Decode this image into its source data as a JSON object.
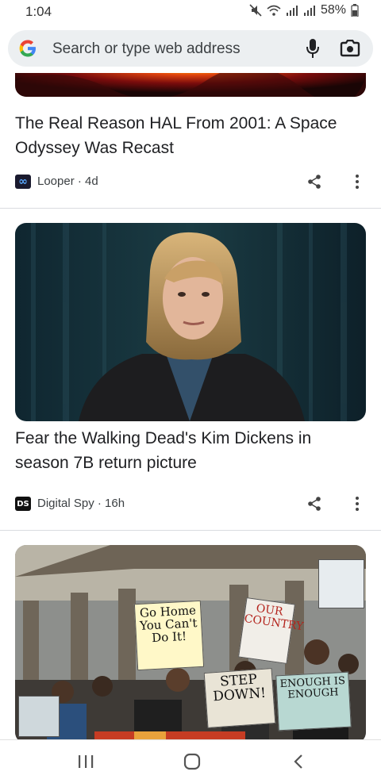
{
  "status": {
    "time": "1:04",
    "battery": "58%",
    "icons": [
      "mute-icon",
      "wifi-icon",
      "signal-icon",
      "signal-icon",
      "battery-icon"
    ]
  },
  "search": {
    "placeholder": "Search or type web address",
    "logo_letter": "G"
  },
  "articles": [
    {
      "title": "The Real Reason HAL From 2001: A Space Odyssey Was Recast",
      "source_logo": "∞",
      "source": "Looper",
      "age": "4d",
      "source_line": "Looper · 4d"
    },
    {
      "title": "Fear the Walking Dead's Kim Dickens in season 7B return picture",
      "source_logo": "DS",
      "source": "Digital Spy",
      "age": "16h",
      "source_line": "Digital Spy · 16h"
    },
    {
      "title": "",
      "signs": {
        "go_home": "Go Home You Can't Do It!",
        "step_down": "STEP DOWN!",
        "enough": "ENOUGH IS ENOUGH",
        "our_country": "OUR COUNTRY"
      }
    }
  ],
  "colors": {
    "accent_blue": "#4285F4",
    "accent_red": "#EA4335",
    "accent_yellow": "#FBBC05",
    "accent_green": "#34A853",
    "search_bg": "#eceff1",
    "divider": "#dadce0"
  },
  "nav": {
    "recents": "recents-icon",
    "home": "home-icon",
    "back": "back-icon"
  }
}
